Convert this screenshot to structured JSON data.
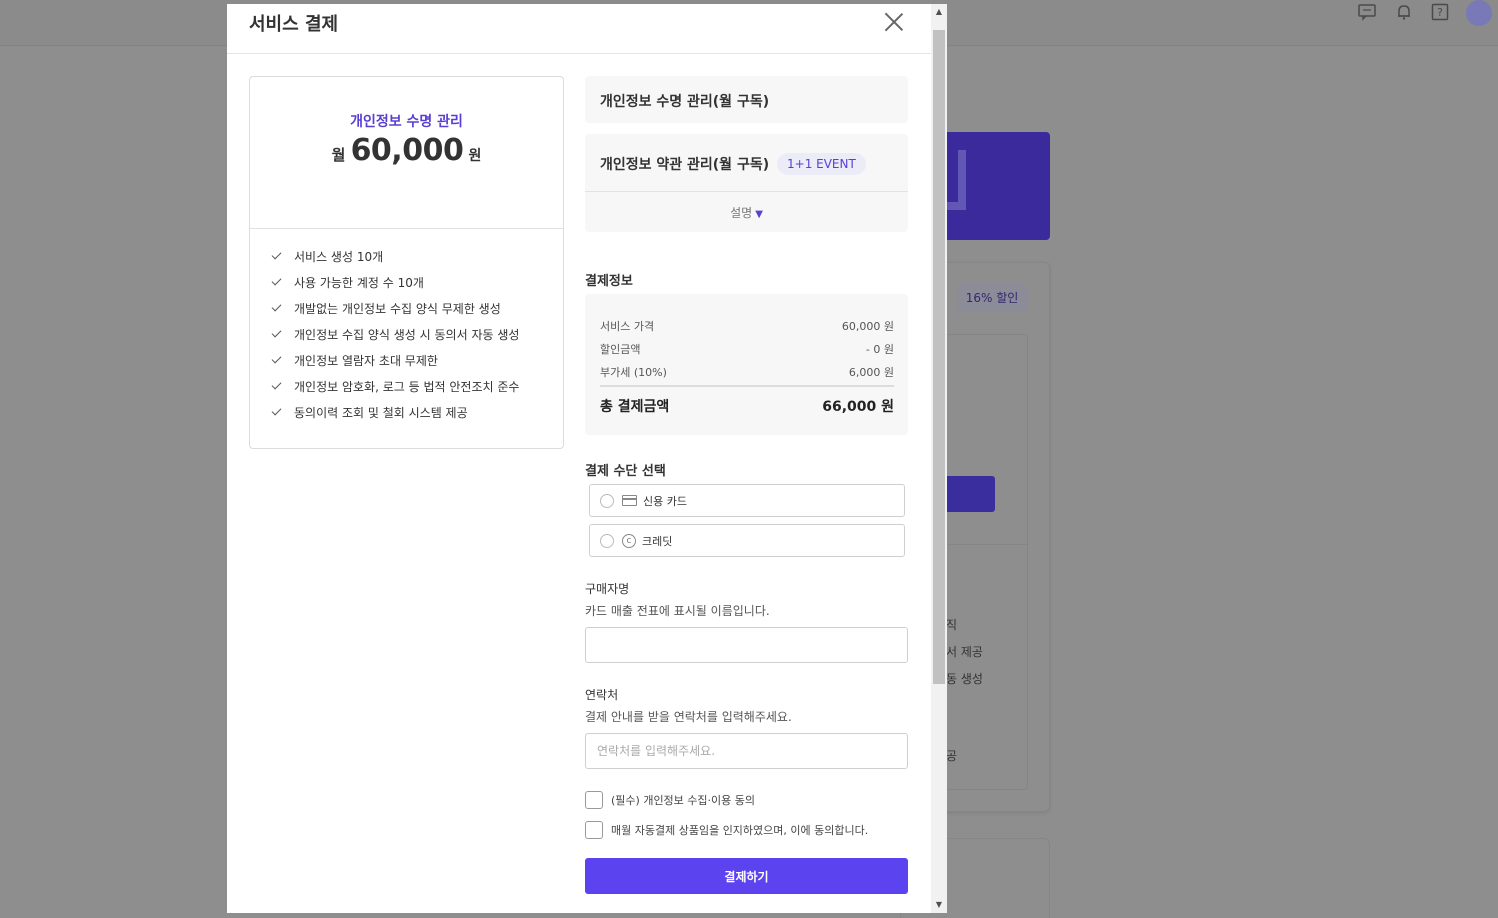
{
  "modal": {
    "title": "서비스 결제"
  },
  "plan": {
    "name": "개인정보 수명 관리",
    "price_prefix": "월",
    "price": "60,000",
    "price_unit": "원",
    "features": [
      "서비스 생성 10개",
      "사용 가능한 계정 수 10개",
      "개발없는 개인정보 수집 양식 무제한 생성",
      "개인정보 수집 양식 생성 시 동의서 자동 생성",
      "개인정보 열람자 초대 무제한",
      "개인정보 암호화, 로그 등 법적 안전조치 준수",
      "동의이력 조회 및 철회 시스템 제공"
    ]
  },
  "products": {
    "item1": "개인정보 수명 관리(월 구독)",
    "item2": "개인정보 약관 관리(월 구독)",
    "event_badge": "1+1 EVENT",
    "description_toggle": "설명"
  },
  "payment_info": {
    "section_label": "결제정보",
    "rows": [
      {
        "label": "서비스 가격",
        "value": "60,000 원"
      },
      {
        "label": "할인금액",
        "value": "- 0 원"
      },
      {
        "label": "부가세 (10%)",
        "value": "6,000 원"
      }
    ],
    "total_label": "총 결제금액",
    "total_value": "66,000 원"
  },
  "payment_method": {
    "section_label": "결제 수단 선택",
    "options": [
      {
        "label": "신용 카드",
        "icon": "credit-card-icon"
      },
      {
        "label": "크레딧",
        "icon": "credit-coin-icon"
      }
    ]
  },
  "buyer": {
    "label": "구매자명",
    "help": "카드 매출 전표에 표시될 이름입니다.",
    "value": "",
    "placeholder": ""
  },
  "contact": {
    "label": "연락처",
    "help": "결제 안내를 받을 연락처를 입력해주세요.",
    "value": "",
    "placeholder": "연락처를 입력해주세요."
  },
  "agreements": [
    "(필수) 개인정보 수집·이용 동의",
    "매월 자동결제 상품임을 인지하였으며, 이에 동의합니다."
  ],
  "submit_label": "결제하기",
  "background": {
    "discount_badge": "16% 할인",
    "partial_texts": [
      "직",
      "서 제공",
      "동 생성",
      "공"
    ]
  },
  "colors": {
    "accent": "#5b43f0",
    "plan_name": "#5a3fd0"
  }
}
